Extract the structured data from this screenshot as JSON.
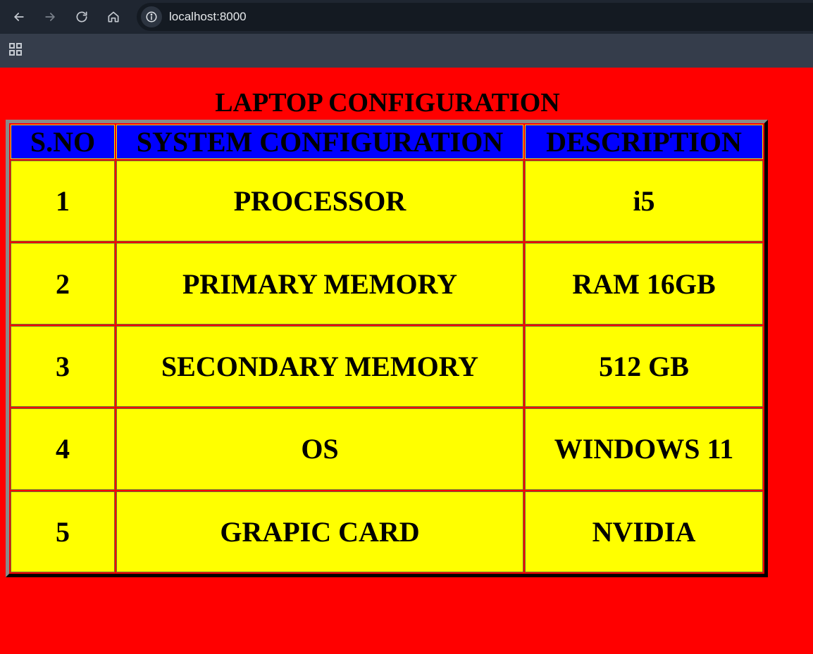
{
  "browser": {
    "url": "localhost:8000",
    "icons": {
      "back": "arrow-left-icon",
      "forward": "arrow-right-icon",
      "reload": "reload-icon",
      "home": "home-icon",
      "site_info": "info-icon",
      "apps": "apps-grid-icon"
    }
  },
  "page": {
    "title": "LAPTOP CONFIGURATION",
    "colors": {
      "background": "#ff0000",
      "header_bg": "#0000ff",
      "cell_bg": "#ffff00"
    }
  },
  "table": {
    "headers": [
      "S.NO",
      "SYSTEM CONFIGURATION",
      "DESCRIPTION"
    ],
    "rows": [
      [
        "1",
        "PROCESSOR",
        "i5"
      ],
      [
        "2",
        "PRIMARY MEMORY",
        "RAM 16GB"
      ],
      [
        "3",
        "SECONDARY MEMORY",
        "512 GB"
      ],
      [
        "4",
        "OS",
        "WINDOWS 11"
      ],
      [
        "5",
        "GRAPIC CARD",
        "NVIDIA"
      ]
    ]
  }
}
